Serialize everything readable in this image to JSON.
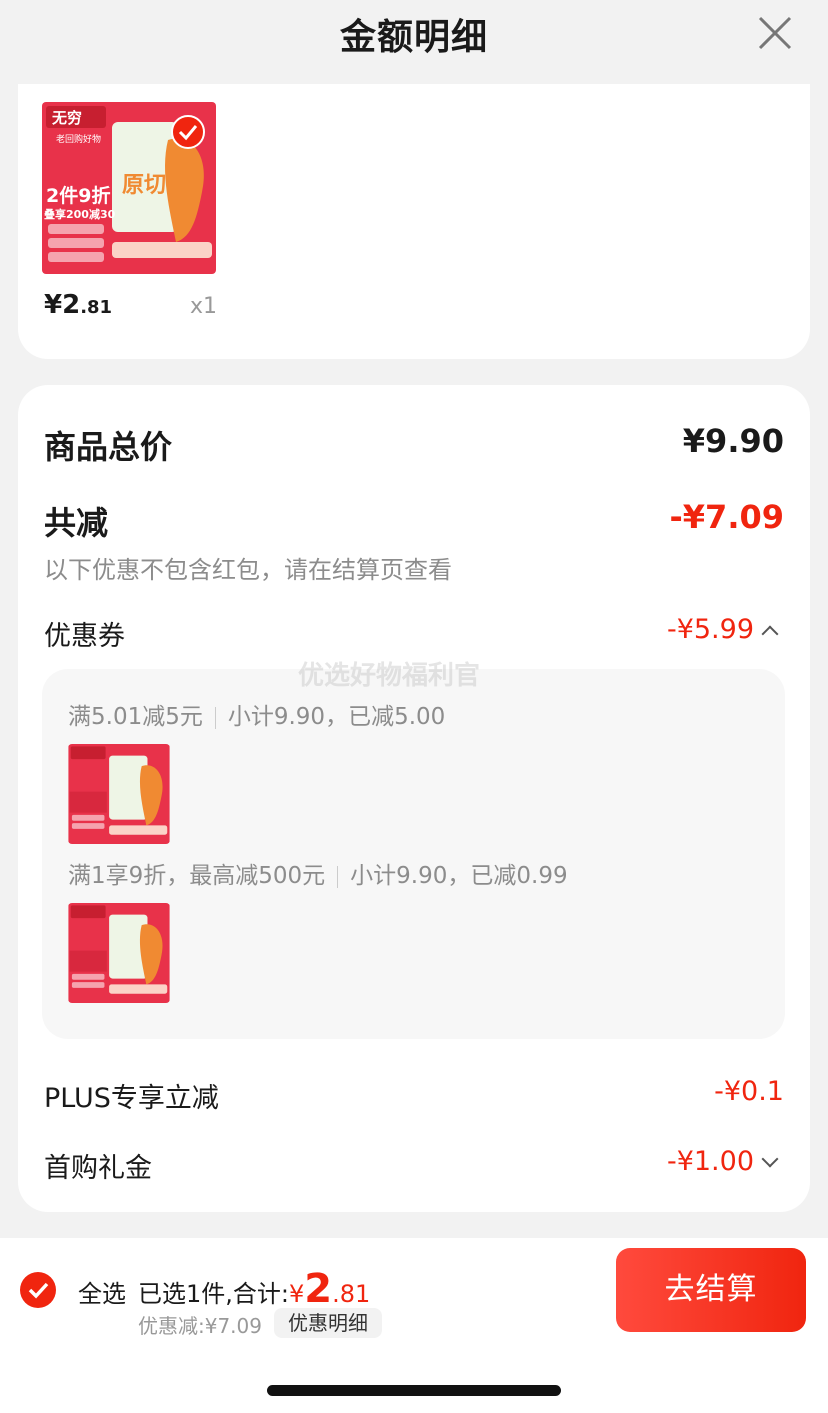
{
  "header": {
    "title": "金额明细"
  },
  "product": {
    "price_int": "¥2",
    "price_dec": ".81",
    "qty": "x1",
    "image_text": {
      "brand": "无穷",
      "sub": "老回购好物",
      "promo1": "2件9折",
      "promo2": "叠享200减30",
      "center": "原切"
    }
  },
  "summary": {
    "goods_total_label": "商品总价",
    "goods_total_value": "¥9.90",
    "total_reduce_label": "共减",
    "total_reduce_value": "-¥7.09",
    "note": "以下优惠不包含红包，请在结算页查看",
    "coupon_label": "优惠券",
    "coupon_value": "-¥5.99",
    "watermark": "优选好物福利官",
    "coupons": [
      {
        "rule": "满5.01减5元",
        "detail": "小计9.90，已减5.00"
      },
      {
        "rule": "满1享9折，最高减500元",
        "detail": "小计9.90，已减0.99"
      }
    ],
    "plus_label": "PLUS专享立减",
    "plus_value": "-¥0.1",
    "gift_label": "首购礼金",
    "gift_value": "-¥1.00"
  },
  "bottom_bar": {
    "select_all": "全选",
    "selected_text": "已选1件,合计:",
    "total_yen": "¥",
    "total_int": "2",
    "total_dec": ".81",
    "discount_text": "优惠减:¥7.09",
    "discount_detail_btn": "优惠明细",
    "checkout_btn": "去结算"
  },
  "colors": {
    "accent": "#f0250f",
    "bg": "#f2f2f2"
  }
}
